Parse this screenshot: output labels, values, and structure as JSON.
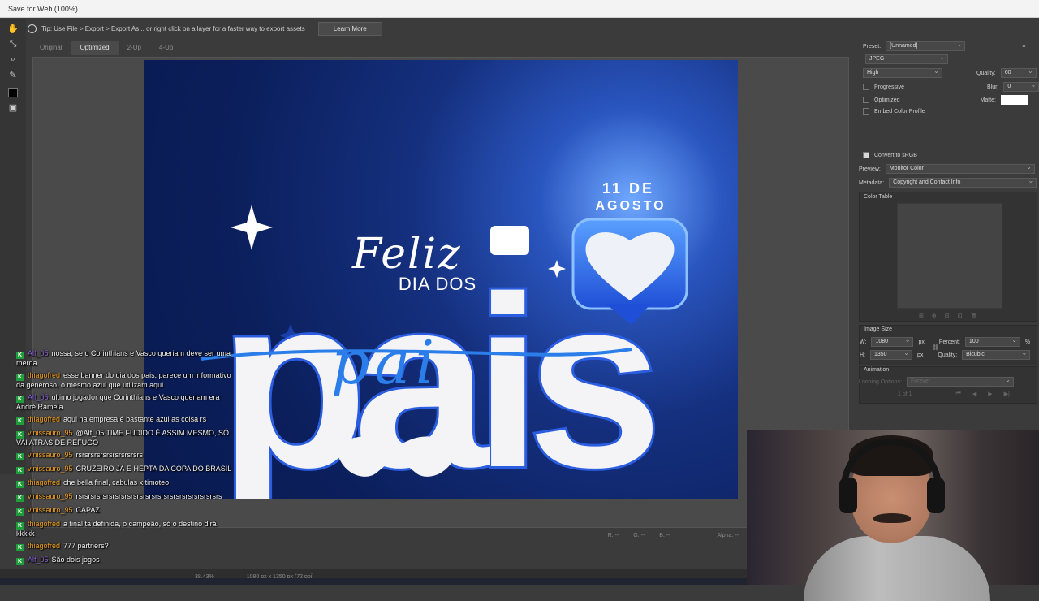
{
  "window": {
    "title": "Save for Web (100%)"
  },
  "tipbar": {
    "text": "Tip: Use File > Export > Export As...  or right click on a layer for a faster way to export assets",
    "learn_more": "Learn More"
  },
  "tabs": [
    {
      "label": "Original"
    },
    {
      "label": "Optimized"
    },
    {
      "label": "2-Up"
    },
    {
      "label": "4-Up"
    }
  ],
  "artwork": {
    "date_line1": "11 DE",
    "date_line2": "AGOSTO",
    "script_text": "Feliz",
    "subtitle": "DIA DOS",
    "big_text": "pais",
    "overlay_script": "pai"
  },
  "panel": {
    "preset_label": "Preset:",
    "preset_value": "[Unnamed]",
    "format": "JPEG",
    "quality_preset": "High",
    "quality_label": "Quality:",
    "quality_value": "60",
    "progressive": "Progressive",
    "blur_label": "Blur:",
    "blur_value": "0",
    "optimized": "Optimized",
    "matte_label": "Matte:",
    "embed_profile": "Embed Color Profile",
    "convert_srgb": "Convert to sRGB",
    "preview_label": "Preview:",
    "preview_value": "Monitor Color",
    "metadata_label": "Metadata:",
    "metadata_value": "Copyright and Contact Info",
    "color_table": "Color Table",
    "image_size": "Image Size",
    "w_label": "W:",
    "w_value": "1080",
    "h_label": "H:",
    "h_value": "1350",
    "px": "px",
    "percent_label": "Percent:",
    "percent_value": "100",
    "percent_unit": "%",
    "size_quality_label": "Quality:",
    "size_quality_value": "Bicubic",
    "animation": "Animation",
    "looping_label": "Looping Options:",
    "looping_value": "Forever",
    "frame_counter": "1 of 1"
  },
  "status": {
    "r": "R: --",
    "g": "G: --",
    "b": "B: --",
    "alpha": "Alpha: --"
  },
  "bottom": {
    "zoom": "38.43%",
    "size": "1080 px x 1350 px (72 ppi)"
  },
  "chat": [
    {
      "user": "Alf_05",
      "color": "#8a63d2",
      "text": "nossa, se o Corinthians e Vasco queriam deve ser uma merda"
    },
    {
      "user": "thiagofred",
      "color": "#f0a020",
      "text": "esse banner do dia dos pais, parece um informativo da generoso, o mesmo azul que utilizam aqui"
    },
    {
      "user": "Alf_05",
      "color": "#8a63d2",
      "text": "ultimo jogador que Corinthians e Vasco queriam era André Ramela"
    },
    {
      "user": "thiagofred",
      "color": "#f0a020",
      "text": "aqui na empresa é bastante azul as coisa rs"
    },
    {
      "user": "vinissauro_95",
      "color": "#f0a020",
      "text": "@Alf_05 TIME FUDIDO É ASSIM MESMO, SÓ VAI ATRAS DE REFUGO"
    },
    {
      "user": "vinissauro_95",
      "color": "#f0a020",
      "text": "rsrsrsrsrsrsrsrsrsrsrs"
    },
    {
      "user": "vinissauro_95",
      "color": "#f0a020",
      "text": "CRUZEIRO JÁ É HEPTA DA COPA DO BRASIL"
    },
    {
      "user": "thiagofred",
      "color": "#f0a020",
      "text": "che bella final, cabulas x timoteo"
    },
    {
      "user": "vinissauro_95",
      "color": "#f0a020",
      "text": "rsrsrsrsrsrsrsrsrsrsrsrsrsrsrsrsrsrsrsrsrsrsrsrs"
    },
    {
      "user": "vinissauro_95",
      "color": "#f0a020",
      "text": "CAPAZ"
    },
    {
      "user": "thiagofred",
      "color": "#f0a020",
      "text": "a final ta definida, o campeão, só o destino dirá kkkkk"
    },
    {
      "user": "thiagofred",
      "color": "#f0a020",
      "text": "777 partners?"
    },
    {
      "user": "Alf_05",
      "color": "#8a63d2",
      "text": "São dois jogos"
    }
  ]
}
